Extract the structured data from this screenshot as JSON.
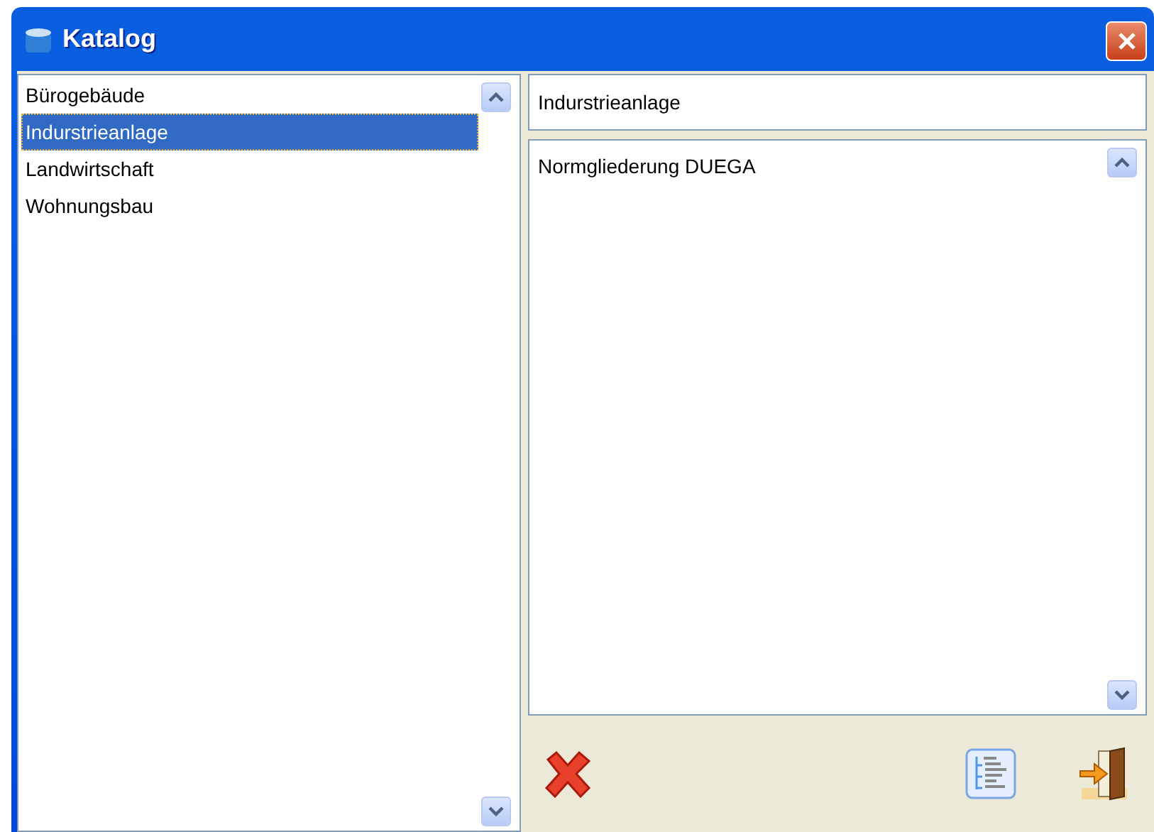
{
  "window": {
    "title": "Katalog"
  },
  "catalog_list": {
    "items": [
      {
        "label": "Bürogebäude",
        "selected": false
      },
      {
        "label": "Indurstrieanlage",
        "selected": true
      },
      {
        "label": "Landwirtschaft",
        "selected": false
      },
      {
        "label": "Wohnungsbau",
        "selected": false
      }
    ]
  },
  "name_field": {
    "value": "Indurstrieanlage"
  },
  "structure_list": {
    "items": [
      "Normgliederung DUEGA"
    ]
  }
}
